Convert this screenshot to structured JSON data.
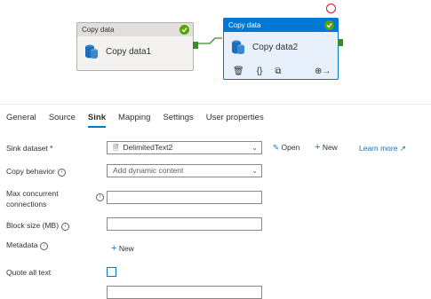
{
  "canvas": {
    "node1": {
      "header": "Copy data",
      "label": "Copy data1"
    },
    "node2": {
      "header": "Copy data",
      "label": "Copy data2"
    }
  },
  "tabs": [
    "General",
    "Source",
    "Sink",
    "Mapping",
    "Settings",
    "User properties"
  ],
  "sink": {
    "dataset_label": "Sink dataset *",
    "dataset_value": "DelimitedText2",
    "open_label": "Open",
    "new_label": "New",
    "learn_more": "Learn more",
    "copy_behavior_label": "Copy behavior",
    "copy_behavior_placeholder": "Add dynamic content",
    "max_conn_label_1": "Max concurrent",
    "max_conn_label_2": "connections",
    "block_size_label": "Block size (MB)",
    "metadata_label": "Metadata",
    "metadata_new": "New",
    "quote_all_label": "Quote all text"
  }
}
